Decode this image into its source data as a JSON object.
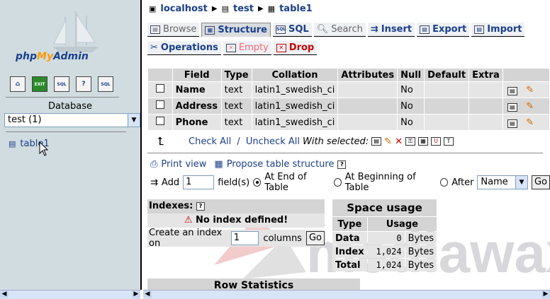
{
  "sidebar": {
    "logo_php": "php",
    "logo_my": "My",
    "logo_admin": "Admin",
    "icons": [
      {
        "name": "home-icon",
        "glyph": "⌂"
      },
      {
        "name": "exit-icon",
        "glyph": "EXIT"
      },
      {
        "name": "sql-icon",
        "glyph": "SQL"
      },
      {
        "name": "help-icon",
        "glyph": "?"
      },
      {
        "name": "docs-icon",
        "glyph": "SQL"
      }
    ],
    "database_label": "Database",
    "database_selected": "test (1)",
    "table_link": "table1"
  },
  "breadcrumb": {
    "server": "localhost",
    "database": "test",
    "table": "table1"
  },
  "tabs_row1": [
    "Browse",
    "Structure",
    "SQL",
    "Search",
    "Insert",
    "Export",
    "Import"
  ],
  "tabs_row2": [
    "Operations",
    "Empty",
    "Drop"
  ],
  "fields_table": {
    "headers": [
      "Field",
      "Type",
      "Collation",
      "Attributes",
      "Null",
      "Default",
      "Extra"
    ],
    "rows": [
      {
        "field": "Name",
        "type": "text",
        "collation": "latin1_swedish_ci",
        "attributes": "",
        "null": "No",
        "default": "",
        "extra": ""
      },
      {
        "field": "Address",
        "type": "text",
        "collation": "latin1_swedish_ci",
        "attributes": "",
        "null": "No",
        "default": "",
        "extra": ""
      },
      {
        "field": "Phone",
        "type": "text",
        "collation": "latin1_swedish_ci",
        "attributes": "",
        "null": "No",
        "default": "",
        "extra": ""
      }
    ]
  },
  "with_selected": {
    "check_all": "Check All",
    "separator": " / ",
    "uncheck_all": "Uncheck All",
    "label": "With selected:"
  },
  "actions": {
    "print_view": "Print view",
    "propose": "Propose table structure",
    "add_label": "Add",
    "add_count": "1",
    "fields_label": "field(s)",
    "at_end": "At End of Table",
    "at_beginning": "At Beginning of Table",
    "after_label": "After",
    "after_field": "Name",
    "go": "Go"
  },
  "indexes": {
    "title": "Indexes:",
    "none": "No index defined!",
    "create_label": "Create an index on",
    "create_count": "1",
    "columns_label": "columns",
    "go": "Go"
  },
  "space_usage": {
    "title": "Space usage",
    "headers": [
      "Type",
      "Usage"
    ],
    "rows": [
      {
        "type": "Data",
        "value": "0",
        "unit": "Bytes"
      },
      {
        "type": "Index",
        "value": "1,024",
        "unit": "Bytes"
      },
      {
        "type": "Total",
        "value": "1,024",
        "unit": "Bytes"
      }
    ]
  },
  "row_statistics": "Row Statistics",
  "watermark": "mediawax"
}
